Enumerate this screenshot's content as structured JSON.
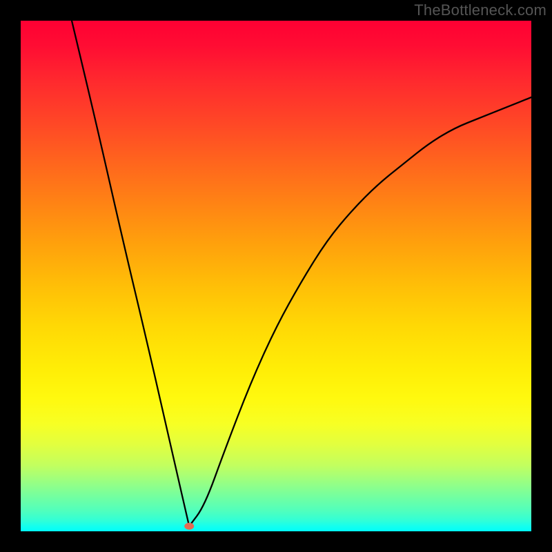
{
  "watermark_text": "TheBottleneck.com",
  "chart_data": {
    "type": "line",
    "title": "",
    "xlabel": "",
    "ylabel": "",
    "xlim": [
      0,
      100
    ],
    "ylim": [
      0,
      100
    ],
    "grid": false,
    "legend": false,
    "background_gradient": {
      "top_color": "#ff0033",
      "mid_color": "#ffd300",
      "bottom_color": "#00ffee"
    },
    "series": [
      {
        "name": "bottleneck-curve",
        "color": "#000000",
        "x": [
          10,
          15,
          20,
          25,
          30,
          33,
          33,
          36,
          40,
          45,
          50,
          55,
          60,
          65,
          70,
          75,
          80,
          85,
          90,
          95,
          100
        ],
        "y": [
          100,
          79,
          57,
          36,
          14,
          1,
          1,
          5,
          16,
          29,
          40,
          49,
          57,
          63,
          68,
          72,
          76,
          79,
          81,
          83,
          85
        ]
      }
    ],
    "marker": {
      "name": "optimum-point",
      "x": 33,
      "y": 1,
      "color": "#e56a54"
    }
  }
}
